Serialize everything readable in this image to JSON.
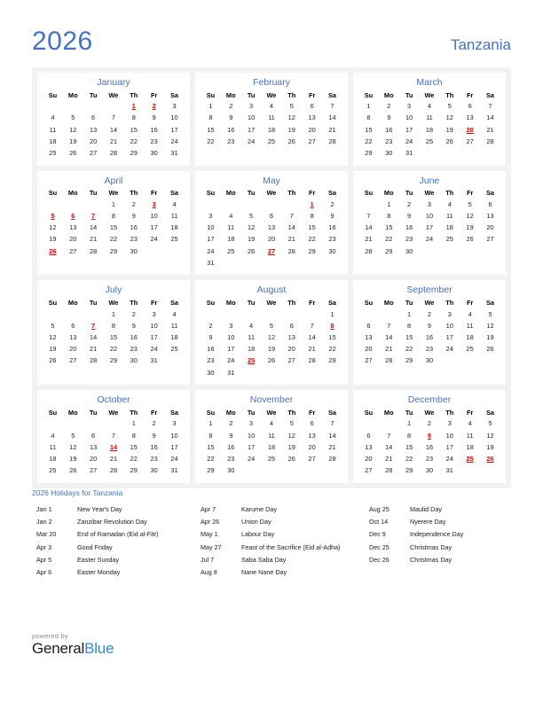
{
  "header": {
    "year": "2026",
    "country": "Tanzania"
  },
  "weekday_headers": [
    "Su",
    "Mo",
    "Tu",
    "We",
    "Th",
    "Fr",
    "Sa"
  ],
  "colors": {
    "accent": "#4472c4",
    "holiday": "#e00000",
    "panel_bg": "#f2f2f2",
    "card_bg": "#ffffff",
    "brand_blue": "#2e8bdc"
  },
  "months": [
    {
      "name": "January",
      "first_weekday": 4,
      "days_in_month": 31,
      "holidays": [
        1,
        2
      ]
    },
    {
      "name": "February",
      "first_weekday": 0,
      "days_in_month": 28,
      "holidays": []
    },
    {
      "name": "March",
      "first_weekday": 0,
      "days_in_month": 31,
      "holidays": [
        20
      ]
    },
    {
      "name": "April",
      "first_weekday": 3,
      "days_in_month": 30,
      "holidays": [
        3,
        5,
        6,
        7,
        26
      ]
    },
    {
      "name": "May",
      "first_weekday": 5,
      "days_in_month": 31,
      "holidays": [
        1,
        27
      ]
    },
    {
      "name": "June",
      "first_weekday": 1,
      "days_in_month": 30,
      "holidays": []
    },
    {
      "name": "July",
      "first_weekday": 3,
      "days_in_month": 31,
      "holidays": [
        7
      ]
    },
    {
      "name": "August",
      "first_weekday": 6,
      "days_in_month": 31,
      "holidays": [
        8,
        25
      ]
    },
    {
      "name": "September",
      "first_weekday": 2,
      "days_in_month": 30,
      "holidays": []
    },
    {
      "name": "October",
      "first_weekday": 4,
      "days_in_month": 31,
      "holidays": [
        14
      ]
    },
    {
      "name": "November",
      "first_weekday": 0,
      "days_in_month": 30,
      "holidays": []
    },
    {
      "name": "December",
      "first_weekday": 2,
      "days_in_month": 31,
      "holidays": [
        9,
        25,
        26
      ]
    }
  ],
  "holidays_section": {
    "title": "2026 Holidays for Tanzania",
    "columns": [
      [
        {
          "date": "Jan 1",
          "name": "New Year's Day"
        },
        {
          "date": "Jan 2",
          "name": "Zanzibar Revolution Day"
        },
        {
          "date": "Mar 20",
          "name": "End of Ramadan (Eid al-Fitr)"
        },
        {
          "date": "Apr 3",
          "name": "Good Friday"
        },
        {
          "date": "Apr 5",
          "name": "Easter Sunday"
        },
        {
          "date": "Apr 6",
          "name": "Easter Monday"
        }
      ],
      [
        {
          "date": "Apr 7",
          "name": "Karume Day"
        },
        {
          "date": "Apr 26",
          "name": "Union Day"
        },
        {
          "date": "May 1",
          "name": "Labour Day"
        },
        {
          "date": "May 27",
          "name": "Feast of the Sacrifice (Eid al-Adha)"
        },
        {
          "date": "Jul 7",
          "name": "Saba Saba Day"
        },
        {
          "date": "Aug 8",
          "name": "Nane Nane Day"
        }
      ],
      [
        {
          "date": "Aug 25",
          "name": "Maulid Day"
        },
        {
          "date": "Oct 14",
          "name": "Nyerere Day"
        },
        {
          "date": "Dec 9",
          "name": "Independence Day"
        },
        {
          "date": "Dec 25",
          "name": "Christmas Day"
        },
        {
          "date": "Dec 26",
          "name": "Christmas Day"
        }
      ]
    ]
  },
  "footer": {
    "powered_by": "powered by",
    "brand_first": "General",
    "brand_second": "Blue"
  }
}
